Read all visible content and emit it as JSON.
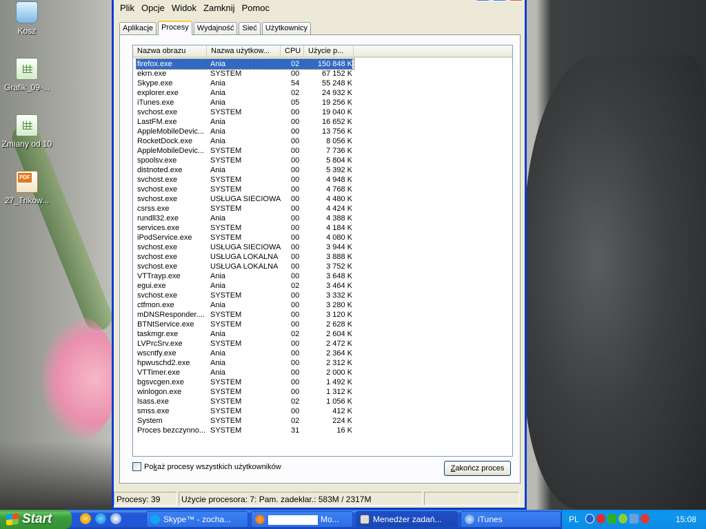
{
  "desktop": {
    "icons": [
      {
        "label": "Kosz"
      },
      {
        "label": "Grafik_09-..."
      },
      {
        "label": "Zmiany od 10"
      },
      {
        "label": "27_Trikow..."
      }
    ]
  },
  "window": {
    "menu": [
      "Plik",
      "Opcje",
      "Widok",
      "Zamknij",
      "Pomoc"
    ],
    "tabs": [
      "Aplikacje",
      "Procesy",
      "Wydajność",
      "Sieć",
      "Użytkownicy"
    ],
    "active_tab": "Procesy",
    "columns": [
      "Nazwa obrazu",
      "Nazwa użytkow...",
      "CPU",
      "Użycie p..."
    ],
    "processes": [
      [
        "firefox.exe",
        "Ania",
        "02",
        "150 848 K"
      ],
      [
        "ekrn.exe",
        "SYSTEM",
        "00",
        "67 152 K"
      ],
      [
        "Skype.exe",
        "Ania",
        "54",
        "55 248 K"
      ],
      [
        "explorer.exe",
        "Ania",
        "02",
        "24 932 K"
      ],
      [
        "iTunes.exe",
        "Ania",
        "05",
        "19 256 K"
      ],
      [
        "svchost.exe",
        "SYSTEM",
        "00",
        "19 040 K"
      ],
      [
        "LastFM.exe",
        "Ania",
        "00",
        "16 652 K"
      ],
      [
        "AppleMobileDevic...",
        "Ania",
        "00",
        "13 756 K"
      ],
      [
        "RocketDock.exe",
        "Ania",
        "00",
        "8 056 K"
      ],
      [
        "AppleMobileDevic...",
        "SYSTEM",
        "00",
        "7 736 K"
      ],
      [
        "spoolsv.exe",
        "SYSTEM",
        "00",
        "5 804 K"
      ],
      [
        "distnoted.exe",
        "Ania",
        "00",
        "5 392 K"
      ],
      [
        "svchost.exe",
        "SYSTEM",
        "00",
        "4 948 K"
      ],
      [
        "svchost.exe",
        "SYSTEM",
        "00",
        "4 768 K"
      ],
      [
        "svchost.exe",
        "USŁUGA SIECIOWA",
        "00",
        "4 480 K"
      ],
      [
        "csrss.exe",
        "SYSTEM",
        "00",
        "4 424 K"
      ],
      [
        "rundll32.exe",
        "Ania",
        "00",
        "4 388 K"
      ],
      [
        "services.exe",
        "SYSTEM",
        "00",
        "4 184 K"
      ],
      [
        "iPodService.exe",
        "SYSTEM",
        "00",
        "4 080 K"
      ],
      [
        "svchost.exe",
        "USŁUGA SIECIOWA",
        "00",
        "3 944 K"
      ],
      [
        "svchost.exe",
        "USŁUGA LOKALNA",
        "00",
        "3 888 K"
      ],
      [
        "svchost.exe",
        "USŁUGA LOKALNA",
        "00",
        "3 752 K"
      ],
      [
        "VTTrayp.exe",
        "Ania",
        "00",
        "3 648 K"
      ],
      [
        "egui.exe",
        "Ania",
        "02",
        "3 464 K"
      ],
      [
        "svchost.exe",
        "SYSTEM",
        "00",
        "3 332 K"
      ],
      [
        "ctfmon.exe",
        "Ania",
        "00",
        "3 280 K"
      ],
      [
        "mDNSResponder....",
        "SYSTEM",
        "00",
        "3 120 K"
      ],
      [
        "BTNtService.exe",
        "SYSTEM",
        "00",
        "2 628 K"
      ],
      [
        "taskmgr.exe",
        "Ania",
        "02",
        "2 604 K"
      ],
      [
        "LVPrcSrv.exe",
        "SYSTEM",
        "00",
        "2 472 K"
      ],
      [
        "wscntfy.exe",
        "Ania",
        "00",
        "2 364 K"
      ],
      [
        "hpwuschd2.exe",
        "Ania",
        "00",
        "2 312 K"
      ],
      [
        "VTTimer.exe",
        "Ania",
        "00",
        "2 000 K"
      ],
      [
        "bgsvcgen.exe",
        "SYSTEM",
        "00",
        "1 492 K"
      ],
      [
        "winlogon.exe",
        "SYSTEM",
        "00",
        "1 312 K"
      ],
      [
        "lsass.exe",
        "SYSTEM",
        "02",
        "1 056 K"
      ],
      [
        "smss.exe",
        "SYSTEM",
        "00",
        "412 K"
      ],
      [
        "System",
        "SYSTEM",
        "02",
        "224 K"
      ],
      [
        "Proces bezczynno...",
        "SYSTEM",
        "31",
        "16 K"
      ]
    ],
    "selected_row": 0,
    "show_all_label_pre": "Po",
    "show_all_label_accel": "k",
    "show_all_label_post": "aż procesy wszystkich użytkowników",
    "end_process_accel": "Z",
    "end_process_rest": "akończ proces",
    "status": {
      "processes": "Procesy: 39",
      "cpu_mem": "Użycie procesora: 7: Pam. zadeklar.: 583M / 2317M",
      "extra": ""
    }
  },
  "taskbar": {
    "start_label": "Start",
    "buttons": [
      {
        "label": "Skype™ - zocha..."
      },
      {
        "label": "Mo..."
      },
      {
        "label": "Menedżer zadań..."
      },
      {
        "label": "iTunes"
      }
    ],
    "tray": {
      "lang": "PL",
      "clock": "15:08"
    }
  },
  "colors": {
    "selection": "#316ac5",
    "title_blue": "#0a3cd0",
    "taskbar_blue": "#2157d7",
    "start_green": "#3a9d3a"
  }
}
